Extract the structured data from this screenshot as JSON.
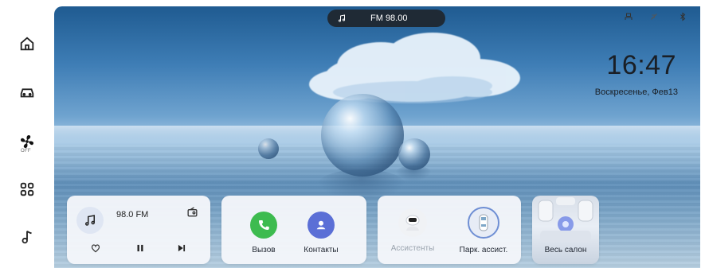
{
  "sidebar": {
    "items": [
      {
        "icon": "home-icon"
      },
      {
        "icon": "car-icon"
      },
      {
        "icon": "fan-icon",
        "status": "OFF"
      },
      {
        "icon": "apps-grid-icon"
      },
      {
        "icon": "music-note-icon"
      }
    ]
  },
  "top_bar": {
    "radio_pill": {
      "icon": "music-note-icon",
      "label": "FM 98.00"
    },
    "status_icons": [
      "profile-icon",
      "signal-off-icon",
      "bluetooth-icon"
    ]
  },
  "clock": {
    "time": "16:47",
    "date": "Воскресенье, Фев13"
  },
  "media_card": {
    "station": "98.0 FM",
    "icons": [
      "music-note-icon",
      "radio-icon",
      "heart-icon",
      "pause-icon",
      "next-track-icon"
    ]
  },
  "phone_card": {
    "call_label": "Вызов",
    "contacts_label": "Контакты",
    "colors": {
      "call": "#3dbb4f",
      "contacts": "#5b6fd6"
    }
  },
  "assist_card": {
    "assistants_label": "Ассистенты",
    "park_assist_label": "Парк. ассист."
  },
  "cabin_card": {
    "label": "Весь салон"
  },
  "colors": {
    "accent": "#5b6fd6",
    "pill": "#1f2a35",
    "text": "#1a1f26"
  }
}
